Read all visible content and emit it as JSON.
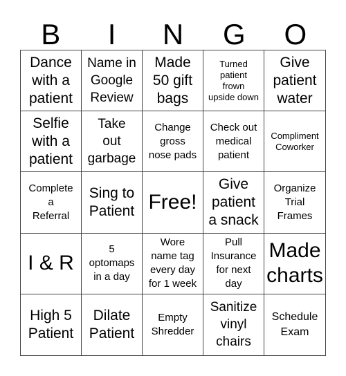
{
  "header": {
    "letters": [
      "B",
      "I",
      "N",
      "G",
      "O"
    ]
  },
  "cells": [
    {
      "text": "Dance with a patient",
      "lines": [
        "Dance",
        "with a",
        "patient"
      ]
    },
    {
      "text": "Name in Google Review",
      "lines": [
        "Name in",
        "Google",
        "Review"
      ]
    },
    {
      "text": "Made 50 gift bags",
      "lines": [
        "Made",
        "50 gift",
        "bags"
      ]
    },
    {
      "text": "Turned patient frown upside down",
      "lines": [
        "Turned",
        "patient",
        "frown",
        "upside down"
      ]
    },
    {
      "text": "Give patient water",
      "lines": [
        "Give",
        "patient",
        "water"
      ]
    },
    {
      "text": "Selfie with a patient",
      "lines": [
        "Selfie",
        "with a",
        "patient"
      ]
    },
    {
      "text": "Take out garbage",
      "lines": [
        "Take",
        "out",
        "garbage"
      ]
    },
    {
      "text": "Change gross nose pads",
      "lines": [
        "Change",
        "gross",
        "nose pads"
      ]
    },
    {
      "text": "Check out medical patient",
      "lines": [
        "Check out",
        "medical",
        "patient"
      ]
    },
    {
      "text": "Compliment Coworker",
      "lines": [
        "Compliment",
        "Coworker"
      ]
    },
    {
      "text": "Complete a Referral",
      "lines": [
        "Complete",
        "a",
        "Referral"
      ]
    },
    {
      "text": "Sing to Patient",
      "lines": [
        "Sing to",
        "Patient"
      ]
    },
    {
      "text": "Free!",
      "lines": [
        "Free!"
      ]
    },
    {
      "text": "Give patient a snack",
      "lines": [
        "Give",
        "patient",
        "a snack"
      ]
    },
    {
      "text": "Organize Trial Frames",
      "lines": [
        "Organize",
        "Trial",
        "Frames"
      ]
    },
    {
      "text": "I & R",
      "lines": [
        "I & R"
      ]
    },
    {
      "text": "5 optomaps in a day",
      "lines": [
        "5",
        "optomaps",
        "in a day"
      ]
    },
    {
      "text": "Wore name tag every day for 1 week",
      "lines": [
        "Wore",
        "name tag",
        "every day",
        "for 1 week"
      ]
    },
    {
      "text": "Pull Insurance for next day",
      "lines": [
        "Pull",
        "Insurance",
        "for next",
        "day"
      ]
    },
    {
      "text": "Made charts",
      "lines": [
        "Made",
        "charts"
      ]
    },
    {
      "text": "High 5 Patient",
      "lines": [
        "High 5",
        "Patient"
      ]
    },
    {
      "text": "Dilate Patient",
      "lines": [
        "Dilate",
        "Patient"
      ]
    },
    {
      "text": "Empty Shredder",
      "lines": [
        "Empty",
        "Shredder"
      ]
    },
    {
      "text": "Sanitize vinyl chairs",
      "lines": [
        "Sanitize",
        "vinyl",
        "chairs"
      ]
    },
    {
      "text": "Schedule Exam",
      "lines": [
        "Schedule",
        "Exam"
      ]
    }
  ]
}
